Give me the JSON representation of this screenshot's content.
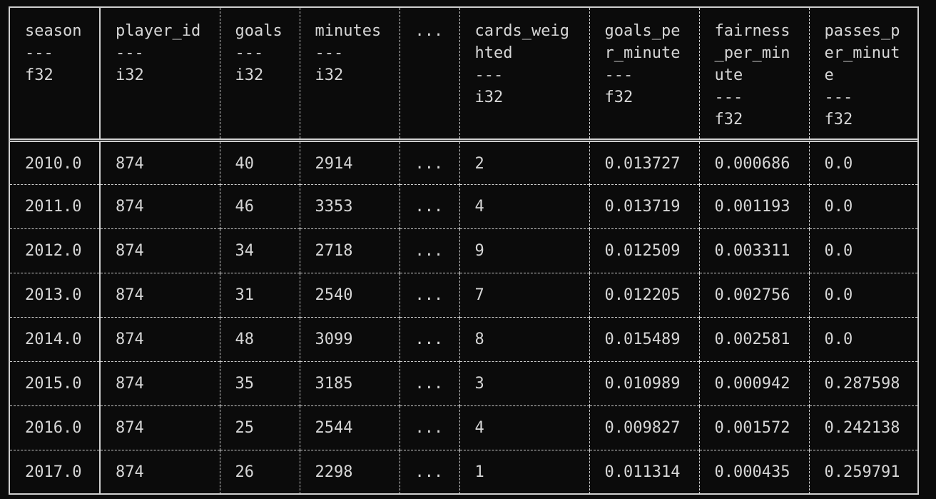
{
  "table": {
    "columns": [
      {
        "name": "season",
        "sep": "---",
        "dtype": "f32"
      },
      {
        "name": "player_id",
        "sep": "---",
        "dtype": "i32"
      },
      {
        "name": "goals",
        "sep": "---",
        "dtype": "i32"
      },
      {
        "name": "minutes",
        "sep": "---",
        "dtype": "i32"
      },
      {
        "name": "...",
        "sep": "",
        "dtype": ""
      },
      {
        "name": "cards_weig\nhted",
        "sep": "---",
        "dtype": "i32"
      },
      {
        "name": "goals_pe\nr_minute",
        "sep": "---",
        "dtype": "f32"
      },
      {
        "name": "fairness\n_per_min\nute",
        "sep": "---",
        "dtype": "f32"
      },
      {
        "name": "passes_p\ner_minut\ne",
        "sep": "---",
        "dtype": "f32"
      }
    ],
    "rows": [
      [
        "2010.0",
        "874",
        "40",
        "2914",
        "...",
        "2",
        "0.013727",
        "0.000686",
        "0.0"
      ],
      [
        "2011.0",
        "874",
        "46",
        "3353",
        "...",
        "4",
        "0.013719",
        "0.001193",
        "0.0"
      ],
      [
        "2012.0",
        "874",
        "34",
        "2718",
        "...",
        "9",
        "0.012509",
        "0.003311",
        "0.0"
      ],
      [
        "2013.0",
        "874",
        "31",
        "2540",
        "...",
        "7",
        "0.012205",
        "0.002756",
        "0.0"
      ],
      [
        "2014.0",
        "874",
        "48",
        "3099",
        "...",
        "8",
        "0.015489",
        "0.002581",
        "0.0"
      ],
      [
        "2015.0",
        "874",
        "35",
        "3185",
        "...",
        "3",
        "0.010989",
        "0.000942",
        "0.287598"
      ],
      [
        "2016.0",
        "874",
        "25",
        "2544",
        "...",
        "4",
        "0.009827",
        "0.001572",
        "0.242138"
      ],
      [
        "2017.0",
        "874",
        "26",
        "2298",
        "...",
        "1",
        "0.011314",
        "0.000435",
        "0.259791"
      ]
    ]
  }
}
